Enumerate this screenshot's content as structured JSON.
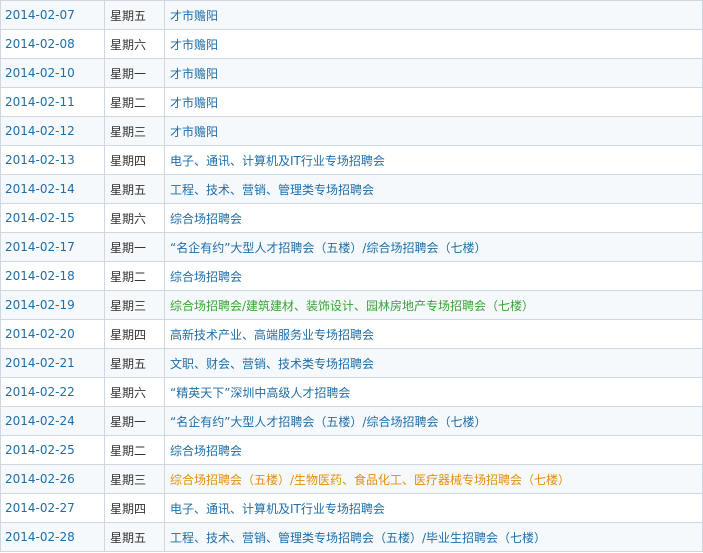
{
  "colors": {
    "link": "#1e6ea7",
    "green": "#3aa236",
    "orange": "#e0900a",
    "text": "#333333",
    "border": "#cfd8e0",
    "row_alt": "#f6f9fc"
  },
  "rows": [
    {
      "date": "2014-02-07",
      "day": "星期五",
      "event": "才市赡阳",
      "color": "link"
    },
    {
      "date": "2014-02-08",
      "day": "星期六",
      "event": "才市赡阳",
      "color": "link"
    },
    {
      "date": "2014-02-10",
      "day": "星期一",
      "event": "才市赡阳",
      "color": "link"
    },
    {
      "date": "2014-02-11",
      "day": "星期二",
      "event": "才市赡阳",
      "color": "link"
    },
    {
      "date": "2014-02-12",
      "day": "星期三",
      "event": "才市赡阳",
      "color": "link"
    },
    {
      "date": "2014-02-13",
      "day": "星期四",
      "event": "电子、通讯、计算机及IT行业专场招聘会",
      "color": "link"
    },
    {
      "date": "2014-02-14",
      "day": "星期五",
      "event": "工程、技术、营销、管理类专场招聘会",
      "color": "link"
    },
    {
      "date": "2014-02-15",
      "day": "星期六",
      "event": "综合场招聘会",
      "color": "link"
    },
    {
      "date": "2014-02-17",
      "day": "星期一",
      "event": "“名企有约”大型人才招聘会（五楼）/综合场招聘会（七楼）",
      "color": "link"
    },
    {
      "date": "2014-02-18",
      "day": "星期二",
      "event": "综合场招聘会",
      "color": "link"
    },
    {
      "date": "2014-02-19",
      "day": "星期三",
      "event": "综合场招聘会/建筑建材、装饰设计、园林房地产专场招聘会（七楼）",
      "color": "green"
    },
    {
      "date": "2014-02-20",
      "day": "星期四",
      "event": "高新技术产业、高端服务业专场招聘会",
      "color": "link"
    },
    {
      "date": "2014-02-21",
      "day": "星期五",
      "event": "文职、财会、营销、技术类专场招聘会",
      "color": "link"
    },
    {
      "date": "2014-02-22",
      "day": "星期六",
      "event": "“精英天下”深圳中高级人才招聘会",
      "color": "link"
    },
    {
      "date": "2014-02-24",
      "day": "星期一",
      "event": "“名企有约”大型人才招聘会（五楼）/综合场招聘会（七楼）",
      "color": "link"
    },
    {
      "date": "2014-02-25",
      "day": "星期二",
      "event": "综合场招聘会",
      "color": "link"
    },
    {
      "date": "2014-02-26",
      "day": "星期三",
      "event": "综合场招聘会（五楼）/生物医药、食品化工、医疗器械专场招聘会（七楼）",
      "color": "orange"
    },
    {
      "date": "2014-02-27",
      "day": "星期四",
      "event": "电子、通讯、计算机及IT行业专场招聘会",
      "color": "link"
    },
    {
      "date": "2014-02-28",
      "day": "星期五",
      "event": "工程、技术、营销、管理类专场招聘会（五楼）/毕业生招聘会（七楼）",
      "color": "link"
    }
  ]
}
